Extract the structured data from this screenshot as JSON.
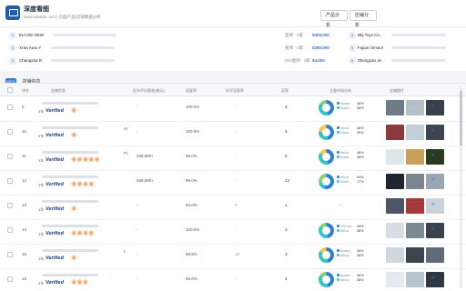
{
  "header": {
    "brand": "深度看图",
    "subbrand": "www.sdukan.com | 页面产品/店铺数据分析",
    "btn_product": "产品分析",
    "btn_store": "店铺分析"
  },
  "companies": [
    {
      "num": "1",
      "name": "ELCOE NEW",
      "tag": "金牌 · 4家",
      "value": "$400,000",
      "num2": "4",
      "name2": "Bbj Toys Co.,"
    },
    {
      "num": "2",
      "name": "Xi'an Auto Y",
      "tag": "金牌 · 4家",
      "value": "$290,000",
      "num2": "5",
      "name2": "Fujian Ominol"
    },
    {
      "num": "3",
      "name": "Changsha R",
      "tag": "ISO金牌 · 4家",
      "value": "$4,000",
      "num2": "6",
      "name2": "Zhengzan Je"
    }
  ],
  "section": {
    "badge": "INFO",
    "label": "店铺信息"
  },
  "table_headers": [
    "排名",
    "店铺信息",
    "近年平均营收(美元)",
    "回复率",
    "好评买家率",
    "买家",
    "主要市场分布",
    "店铺图片"
  ],
  "rows": [
    {
      "rank": "9",
      "col3": "-",
      "pct": "100.0%",
      "dash": "-",
      "count": "3",
      "hearts": "🏵",
      "mid": "",
      "legend": [
        "Austra...",
        "South..."
      ],
      "lgpct": [
        "46%",
        "38%"
      ],
      "donut": "conic-gradient(#2e7fd6 0 46%, #37c4c9 46% 84%, #8ad26e 84% 100%)",
      "thumbs": [
        "#6e7a86",
        "#b5c0c8",
        "#38414a"
      ]
    },
    {
      "rank": "10",
      "col3": "-",
      "pct": "100.0%",
      "dash": "-",
      "count": "3",
      "hearts": "🏵",
      "mid": "AI",
      "legend": [
        "Africa",
        "South..."
      ],
      "lgpct": [
        "46%",
        "30%"
      ],
      "donut": "conic-gradient(#2e7fd6 0 46%, #37c4c9 46% 76%, #f2c94c 76% 100%)",
      "thumbs": [
        "#8a3a3a",
        "#c2cfd9",
        "#3d4650"
      ]
    },
    {
      "rank": "11",
      "col3": "468,890+",
      "pct": "95.0%",
      "dash": "-",
      "count": "6",
      "hearts": "🏵🏵🏵🏵🏵",
      "mid": "Fl.",
      "legend": [
        "Africa",
        "South..."
      ],
      "lgpct": [
        "46%",
        "38%"
      ],
      "donut": "conic-gradient(#2e7fd6 0 46%, #37c4c9 46% 84%, #f2c94c 84% 100%)",
      "thumbs": [
        "#dfe6ea",
        "#c9a05a",
        "#2b3a22"
      ]
    },
    {
      "rank": "12",
      "col3": "468,890+",
      "pct": "96.0%",
      "dash": "-",
      "count": "12",
      "hearts": "🏵🏵🏵🏵",
      "mid": "",
      "legend": [
        "Africa",
        "South..."
      ],
      "lgpct": [
        "54%",
        "17%"
      ],
      "donut": "conic-gradient(#2e7fd6 0 54%, #37c4c9 54% 71%, #8ad26e 71% 100%)",
      "thumbs": [
        "#1e2730",
        "#7b8692",
        "#9aa6b1"
      ]
    },
    {
      "rank": "13",
      "col3": "-",
      "pct": "94.0%",
      "dash": "8",
      "count": "1",
      "hearts": "🏵",
      "mid": "",
      "legend": [],
      "lgpct": [],
      "donut": "",
      "thumbs": [
        "#4c5763",
        "#a63a3a",
        "#c8d3db"
      ]
    },
    {
      "rank": "14",
      "col3": "-",
      "pct": "100.0%",
      "dash": "-",
      "count": "3",
      "hearts": "🏵🏵🏵🏵",
      "mid": "",
      "legend": [
        "NOCam",
        "Africa"
      ],
      "lgpct": [
        "46%",
        "38%"
      ],
      "donut": "conic-gradient(#2e7fd6 0 46%, #37c4c9 46% 84%, #8ad26e 84% 100%)",
      "thumbs": [
        "#d7dde2",
        "#7d8893",
        "#3a434d"
      ]
    },
    {
      "rank": "15",
      "col3": "-",
      "pct": "98.8%",
      "dash": "13",
      "count": "3",
      "hearts": "🏵",
      "mid": "t.",
      "legend": [
        "Austra...",
        "Africa"
      ],
      "lgpct": [
        "46%",
        "38%"
      ],
      "donut": "conic-gradient(#2e7fd6 0 46%, #37c4c9 46% 84%, #f2c94c 84% 100%)",
      "thumbs": [
        "#cfd8df",
        "#3c4450",
        "#5f6b77"
      ]
    },
    {
      "rank": "16",
      "col3": "-",
      "pct": "95.0%",
      "dash": "-",
      "count": "3",
      "hearts": "🏵🏵🏵",
      "mid": "",
      "legend": [
        "Austra...",
        "Africa"
      ],
      "lgpct": [
        "46%",
        "38%"
      ],
      "donut": "conic-gradient(#2e7fd6 0 46%, #37c4c9 46% 84%, #8ad26e 84% 100%)",
      "thumbs": [
        "#e5eaee",
        "#b9c3cc",
        "#2f3842"
      ]
    }
  ],
  "verified_text": "Verified",
  "verified_prefix": "3年",
  "more_label": "»"
}
